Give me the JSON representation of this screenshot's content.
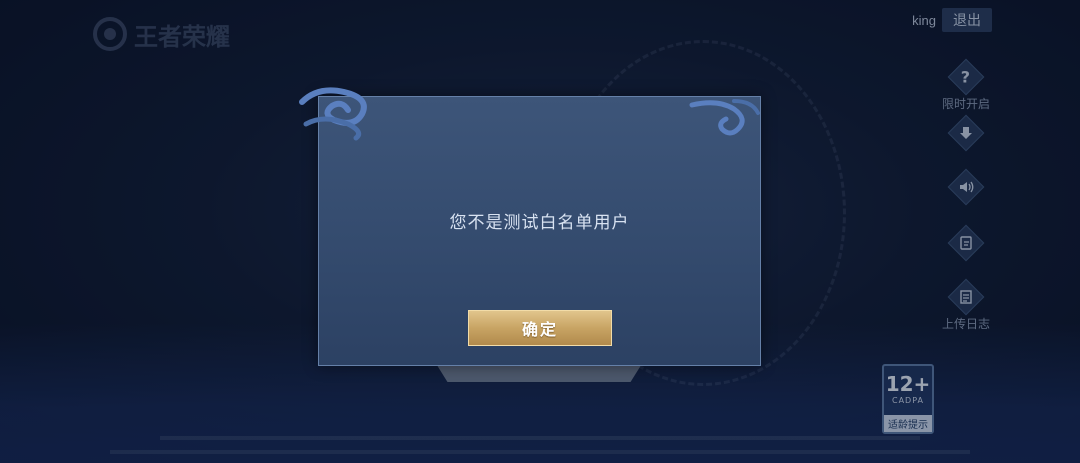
{
  "logo": {
    "text": "王者荣耀"
  },
  "header": {
    "username": "king",
    "logout_label": "退出"
  },
  "side_menu": [
    {
      "icon": "help-icon",
      "label": "限时开启"
    },
    {
      "icon": "download-icon",
      "label": ""
    },
    {
      "icon": "speaker-icon",
      "label": ""
    },
    {
      "icon": "swap-icon",
      "label": ""
    },
    {
      "icon": "log-icon",
      "label": "上传日志"
    }
  ],
  "age_rating": {
    "number": "12+",
    "org": "CADPA",
    "tip": "适龄提示"
  },
  "dialog": {
    "message": "您不是测试白名单用户",
    "confirm_label": "确定"
  },
  "colors": {
    "accent_gold": "#c8a464",
    "dialog_bg": "#344b6e",
    "background": "#111d36"
  }
}
